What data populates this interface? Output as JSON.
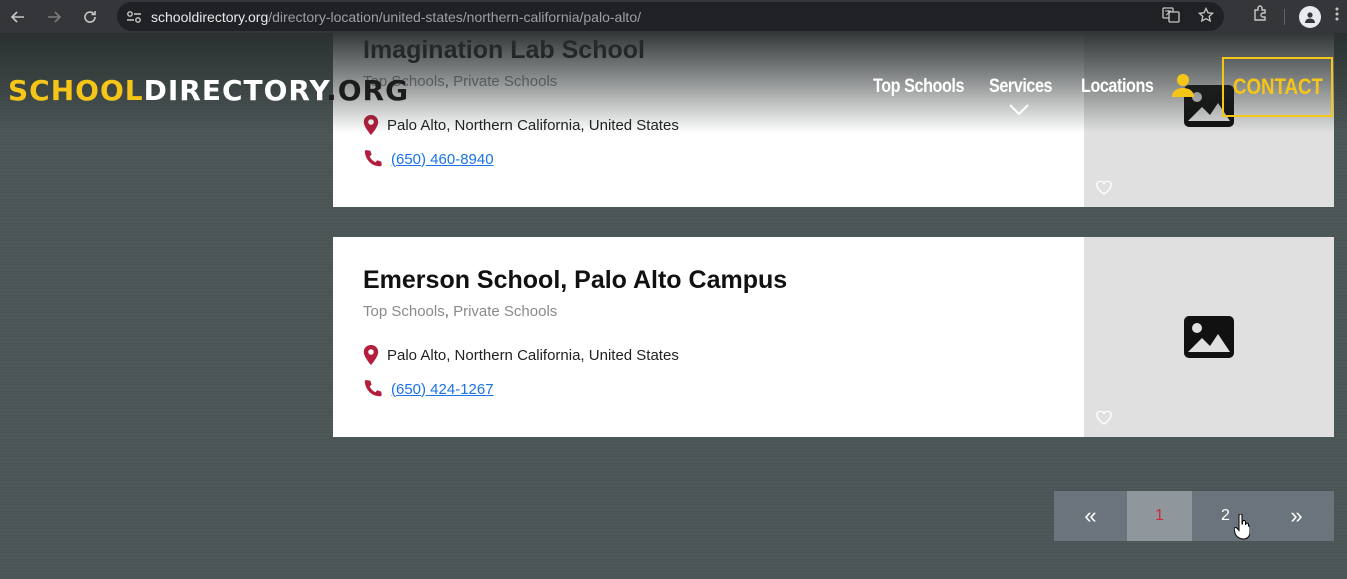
{
  "browser": {
    "url_host": "schooldirectory.org",
    "url_path": "/directory-location/united-states/northern-california/palo-alto/",
    "back_icon": "arrow-left-icon",
    "forward_icon": "arrow-right-icon",
    "reload_icon": "reload-icon"
  },
  "site": {
    "logo_part1": "SCHOOL",
    "logo_part2": "DIRECTORY",
    "logo_part3": ".ORG",
    "brand_color": "#f5c518",
    "nav": {
      "top_schools": "Top Schools",
      "services": "Services",
      "locations": "Locations",
      "contact": "CONTACT"
    }
  },
  "schools": [
    {
      "name": "Imagination Lab School",
      "category1": "Top Schools",
      "category_sep": ",",
      "category2": "Private Schools",
      "location": "Palo Alto, Northern California, United States",
      "phone": "(650) 460-8940"
    },
    {
      "name": "Emerson School, Palo Alto Campus",
      "category1": "Top Schools",
      "category_sep": ",",
      "category2": "Private Schools",
      "location": "Palo Alto, Northern California, United States",
      "phone": "(650) 424-1267"
    }
  ],
  "pagination": {
    "first": "«",
    "current": "1",
    "page2": "2",
    "last": "»",
    "current_color": "#cc2b3b"
  }
}
